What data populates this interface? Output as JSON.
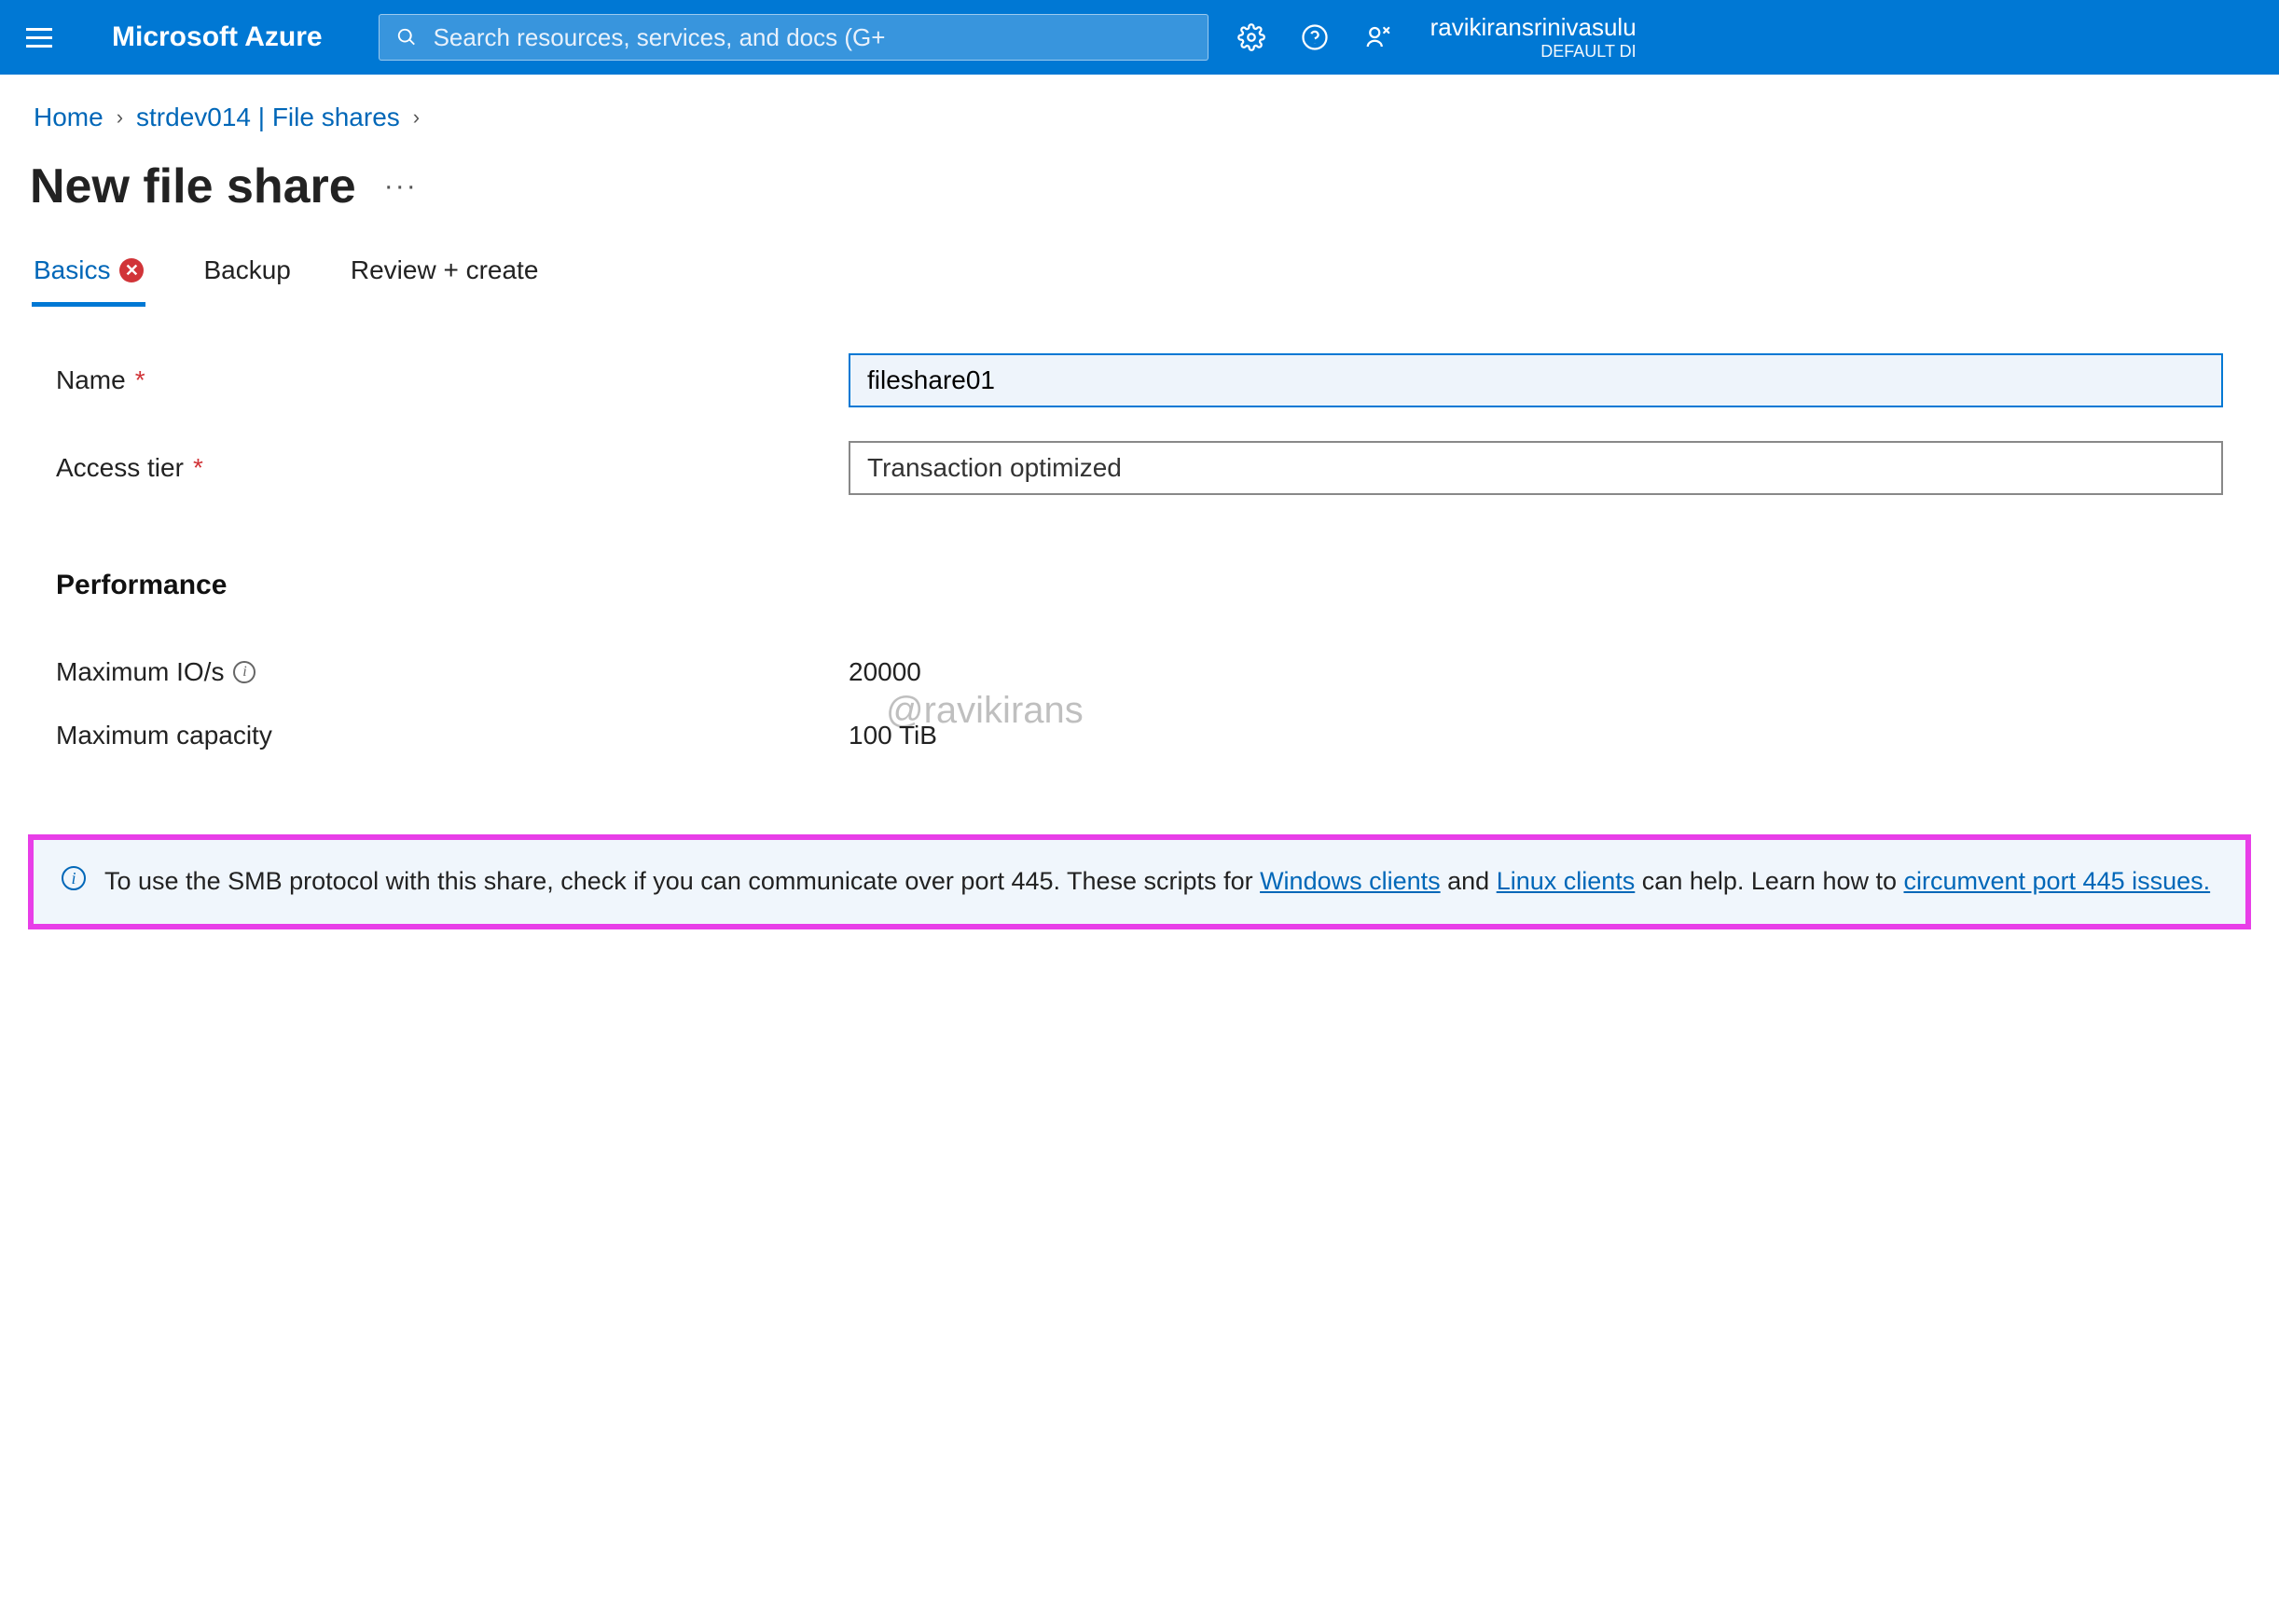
{
  "header": {
    "brand": "Microsoft Azure",
    "search_placeholder": "Search resources, services, and docs (G+",
    "user_name": "ravikiransrinivasulu",
    "user_directory": "DEFAULT DI"
  },
  "breadcrumb": {
    "items": [
      {
        "label": "Home"
      },
      {
        "label": "strdev014 | File shares"
      }
    ]
  },
  "page": {
    "title": "New file share"
  },
  "tabs": [
    {
      "label": "Basics",
      "active": true,
      "error": true
    },
    {
      "label": "Backup",
      "active": false,
      "error": false
    },
    {
      "label": "Review + create",
      "active": false,
      "error": false
    }
  ],
  "form": {
    "name_label": "Name",
    "name_value": "fileshare01",
    "tier_label": "Access tier",
    "tier_value": "Transaction optimized"
  },
  "watermark": "@ravikirans",
  "performance": {
    "heading": "Performance",
    "io_label": "Maximum IO/s",
    "io_value": "20000",
    "cap_label": "Maximum capacity",
    "cap_value": "100 TiB"
  },
  "banner": {
    "text_a": "To use the SMB protocol with this share, check if you can communicate over port 445. These scripts for ",
    "link_windows": "Windows clients",
    "text_b": " and ",
    "link_linux": "Linux clients",
    "text_c": " can help. Learn how to ",
    "link_circ": "circumvent port 445 issues."
  }
}
